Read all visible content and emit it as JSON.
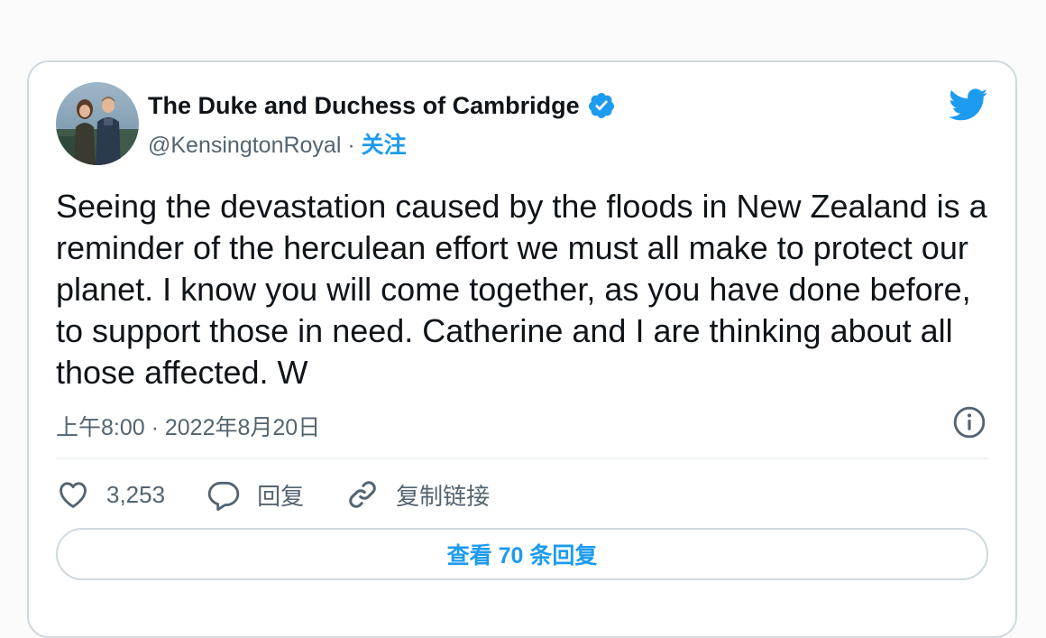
{
  "author": {
    "display_name": "The Duke and Duchess of Cambridge",
    "handle": "@KensingtonRoyal",
    "separator": " · ",
    "follow_label": "关注",
    "verified": true
  },
  "tweet": {
    "text": "Seeing the devastation caused by the floods in New Zealand is a reminder of the herculean effort we must all make to protect our planet. I know you will come together, as you have done before, to support those in need. Catherine and I are thinking about all those affected. W",
    "timestamp": "上午8:00 · 2022年8月20日"
  },
  "actions": {
    "like_count": "3,253",
    "reply_label": "回复",
    "copy_link_label": "复制链接"
  },
  "replies_button_label": "查看 70 条回复",
  "icons": {
    "brand": "twitter-bird-icon",
    "verified": "verified-badge-icon",
    "info": "info-icon",
    "like": "heart-icon",
    "reply": "speech-bubble-icon",
    "copy_link": "link-icon"
  },
  "colors": {
    "accent": "#1d9bf0",
    "text_primary": "#0f1419",
    "text_secondary": "#536471",
    "border": "#cfd9de"
  }
}
